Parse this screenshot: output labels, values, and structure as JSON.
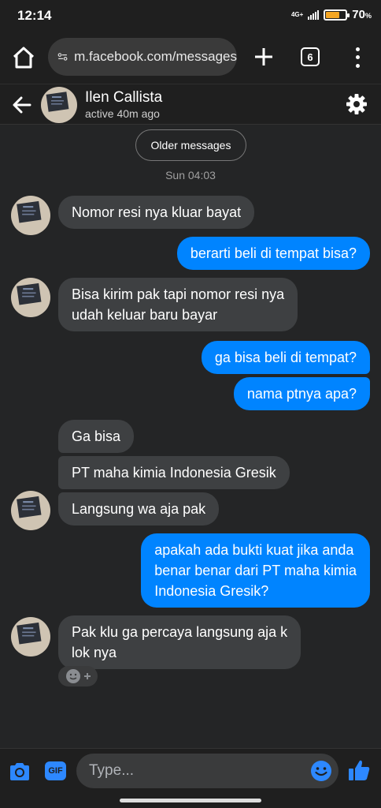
{
  "status_bar": {
    "time": "12:14",
    "network": "4G+",
    "battery_percent": "70",
    "battery_unit": "%",
    "battery_level": 0.7
  },
  "browser": {
    "url": "m.facebook.com/messages",
    "tab_count": "6"
  },
  "chat": {
    "contact_name": "Ilen Callista",
    "contact_status": "active 40m ago"
  },
  "messages_area": {
    "older_messages_label": "Older messages",
    "timestamp": "Sun 04:03",
    "messages": [
      {
        "direction": "in",
        "lines": [
          "Nomor resi nya kluar bayat"
        ]
      },
      {
        "direction": "out",
        "lines": [
          "berarti beli di tempat bisa?"
        ]
      },
      {
        "direction": "in",
        "lines": [
          "Bisa kirim pak tapi nomor resi nya",
          "udah keluar baru bayar"
        ]
      },
      {
        "direction": "out",
        "lines": [
          "ga bisa beli di tempat?"
        ]
      },
      {
        "direction": "out",
        "lines": [
          "nama ptnya apa?"
        ]
      },
      {
        "direction": "in",
        "lines": [
          "Ga bisa"
        ]
      },
      {
        "direction": "in",
        "lines": [
          "PT maha kimia Indonesia Gresik"
        ]
      },
      {
        "direction": "in",
        "lines": [
          "Langsung wa aja pak"
        ]
      },
      {
        "direction": "out",
        "lines": [
          "apakah ada bukti kuat jika anda",
          "benar benar dari PT maha kimia",
          "Indonesia Gresik?"
        ]
      },
      {
        "direction": "in",
        "lines": [
          "Pak klu ga percaya langsung aja k",
          "lok nya"
        ]
      }
    ]
  },
  "composer": {
    "placeholder": "Type...",
    "gif_label": "GIF"
  },
  "icons": [
    "home-icon",
    "site-info-icon",
    "plus-icon",
    "tabs-icon",
    "menu-icon",
    "back-arrow-icon",
    "gear-icon",
    "camera-icon",
    "emoji-icon",
    "like-icon",
    "react-icon"
  ],
  "colors": {
    "outgoing_bubble": "#0084ff",
    "incoming_bubble": "#3e4042",
    "accent": "#2d88ff",
    "battery": "#f5a623"
  }
}
